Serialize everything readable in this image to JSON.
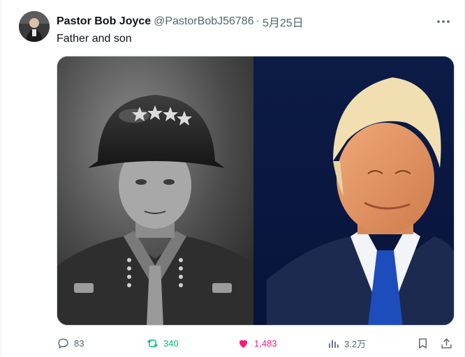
{
  "author": {
    "display_name": "Pastor Bob Joyce",
    "handle": "@PastorBobJ56786",
    "separator": "·",
    "date": "5月25日"
  },
  "tweet": {
    "text": "Father and son"
  },
  "media": {
    "left_subject": "helmeted soldier portrait (black and white)",
    "right_subject": "man in suit with blue tie (color)"
  },
  "actions": {
    "replies": "83",
    "retweets": "340",
    "likes": "1,483",
    "views": "3.2万"
  },
  "colors": {
    "retweet": "#00ba7c",
    "like": "#f91880",
    "muted": "#536471",
    "text": "#0f1419"
  },
  "icons": {
    "more": "more-icon",
    "reply": "reply-icon",
    "retweet": "retweet-icon",
    "like": "heart-icon",
    "views": "views-icon",
    "bookmark": "bookmark-icon",
    "share": "share-icon"
  }
}
